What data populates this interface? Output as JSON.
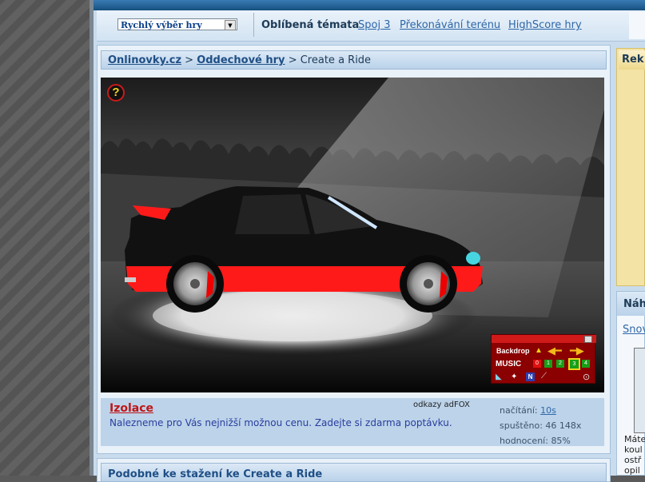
{
  "nav": {
    "quick_select": "Rychlý výběr hry",
    "favorites_label": "Oblíbená témata",
    "links": [
      "Spoj 3",
      "Překonávání terénu",
      "HighScore hry"
    ]
  },
  "breadcrumb": {
    "home": "Onlinovky.cz",
    "category": "Oddechové hry",
    "current": "Create a Ride",
    "separator": ">"
  },
  "game": {
    "help_symbol": "?",
    "panel": {
      "backdrop_label": "Backdrop",
      "music_label": "MUSIC",
      "music_tracks": [
        "0",
        "1",
        "2",
        "3",
        "4"
      ],
      "selected_track": "3",
      "n_label": "N"
    }
  },
  "ad": {
    "title": "Izolace",
    "text": "Nalezneme pro Vás nejnižší možnou cenu. Zadejte si zdarma poptávku.",
    "source": "odkazy adFOX"
  },
  "stats": {
    "load_label": "načítání:",
    "load_value": "10s",
    "runs_label": "spuštěno:",
    "runs_value": "46 148x",
    "rating_label": "hodnocení:",
    "rating_value": "85%"
  },
  "bottom": {
    "title": "Podobné ke stažení ke Create a Ride"
  },
  "right": {
    "rek_title": "Rek",
    "nah_title": "Náh",
    "nah_link": "Snov",
    "nah_text": [
      "Máte",
      "koul",
      "ostř",
      "opil"
    ]
  },
  "colors": {
    "accent_blue": "#2f67a8",
    "car_red": "#ff1a1a",
    "ad_red": "#c01616"
  }
}
